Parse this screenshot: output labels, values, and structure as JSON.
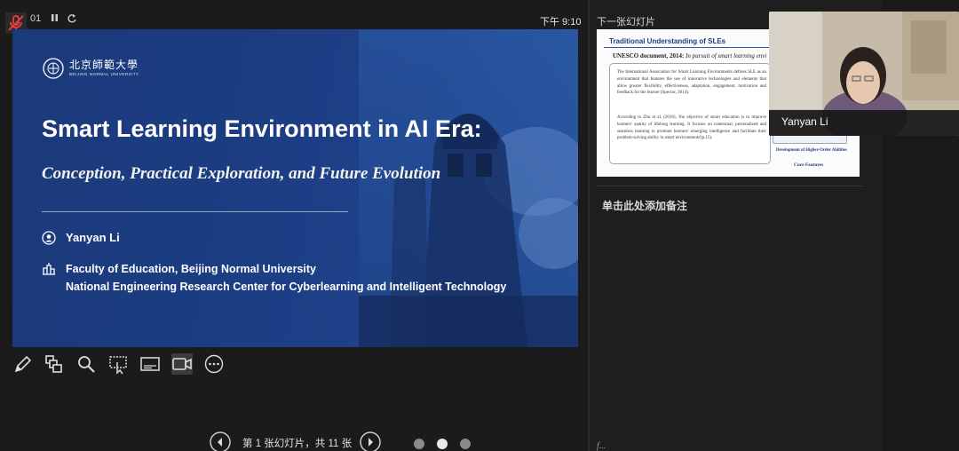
{
  "topbar": {
    "timer": "01",
    "clock": "下午 9:10"
  },
  "slide": {
    "logo_text": "北京師範大學",
    "logo_sub": "BEIJING NORMAL UNIVERSITY",
    "title": "Smart Learning Environment in AI Era:",
    "subtitle": "Conception, Practical Exploration, and Future Evolution",
    "author": "Yanyan Li",
    "institution_line1": "Faculty of Education, Beijing Normal University",
    "institution_line2": "National Engineering Research Center for Cyberlearning and Intelligent Technology"
  },
  "nav": {
    "slide_counter": "第 1 张幻灯片，共 11 张"
  },
  "right_panel": {
    "next_label": "下一张幻灯片",
    "next_slide": {
      "title": "Traditional Understanding of SLEs",
      "subtitle_bold": "UNESCO document, 2014:",
      "subtitle_italic": " In pursuit of smart learning envi",
      "para1": "The International Association for Smart Learning Environments defines SLE as an environment that features the use of innovative technologies and elements that allow greater flexibility, effectiveness, adaptation, engagement, motivation and feedback for the learner (Spector, 2014).",
      "para2": "According to Zhu et al. (2016), 'the objective of smart education is to improve learners' quality of lifelong learning. It focuses on contextual, personalized and seamless learning to promote learners' emerging intelligence and facilitate their problem-solving ability in smart environments'(p.15).",
      "card_text": "Development of Higher-Order Abilities",
      "core": "Core Features"
    },
    "notes_placeholder": "单击此处添加备注",
    "notes_bottom": "f..."
  },
  "webcam": {
    "name": "Yanyan Li"
  },
  "colors": {
    "slide_bg": "#1d3d84",
    "accent": "#2b5aa6"
  },
  "icons": [
    "mic-off-icon",
    "pause-icon",
    "reset-icon",
    "pen-icon",
    "slides-grid-icon",
    "zoom-icon",
    "pointer-screen-icon",
    "subtitles-icon",
    "camera-icon",
    "more-icon",
    "prev-icon",
    "next-icon"
  ]
}
